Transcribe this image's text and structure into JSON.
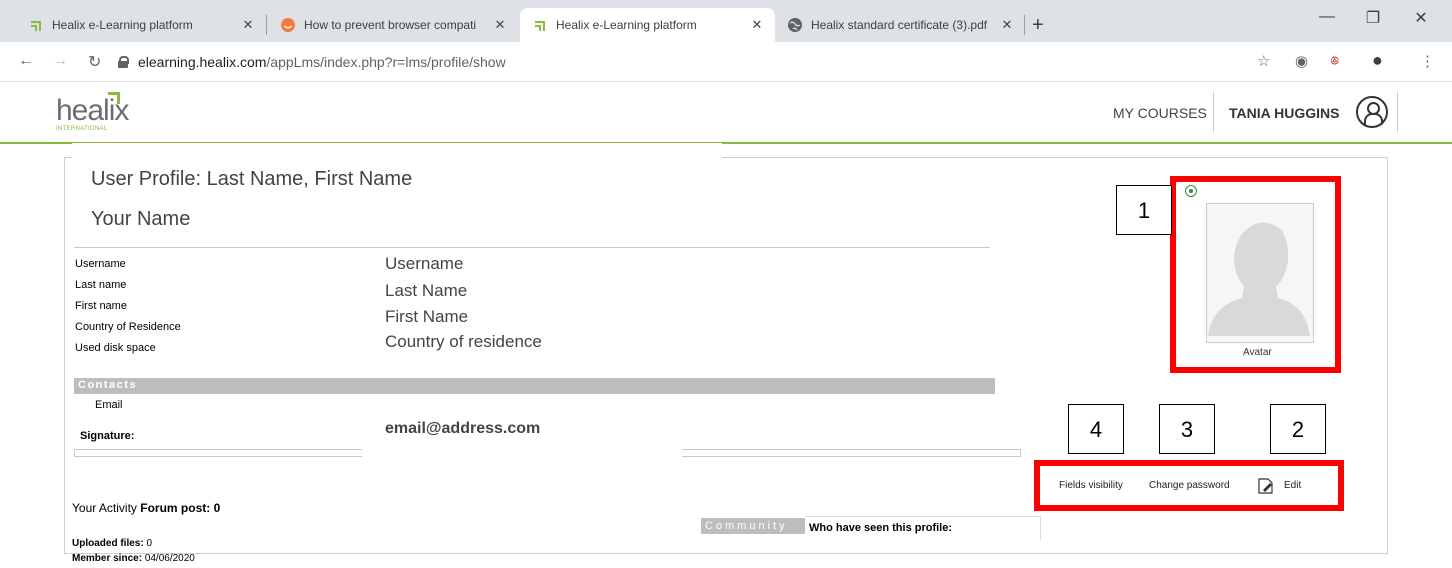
{
  "browser": {
    "tabs": [
      {
        "title": "Healix e-Learning platform",
        "favicon": "healix-icon",
        "active": false
      },
      {
        "title": "How to prevent browser compati",
        "favicon": "orange-smiley-icon",
        "active": false
      },
      {
        "title": "Healix e-Learning platform",
        "favicon": "healix-icon",
        "active": true
      },
      {
        "title": "Healix standard certificate (3).pdf",
        "favicon": "globe-icon",
        "active": false
      }
    ],
    "url_host": "elearning.healix.com",
    "url_path": "/appLms/index.php?r=lms/profile/show"
  },
  "site": {
    "logo_text": "healix",
    "logo_sub": "INTERNATIONAL",
    "nav_courses": "MY COURSES",
    "nav_user": "TANIA HUGGINS"
  },
  "profile": {
    "title": "User Profile: Last Name, First Name",
    "name": "Your Name",
    "fields": [
      {
        "label": "Username",
        "value": "Username"
      },
      {
        "label": "Last name",
        "value": "Last Name"
      },
      {
        "label": "First name",
        "value": "First Name"
      },
      {
        "label": "Country of Residence",
        "value": "Country of residence"
      },
      {
        "label": "Used disk space",
        "value": ""
      }
    ],
    "contacts_header": "Contacts",
    "email_label": "Email",
    "email_value": "email@address.com",
    "signature_label": "Signature:",
    "avatar_label": "Avatar",
    "actions": {
      "fields_visibility": "Fields visibility",
      "change_password": "Change password",
      "edit": "Edit"
    }
  },
  "activity": {
    "label": "Your Activity",
    "forum_post_label": "Forum post:",
    "forum_post_value": "0",
    "uploaded_files_label": "Uploaded files:",
    "uploaded_files_value": "0",
    "member_since_label": "Member since:",
    "member_since_value": "04/06/2020"
  },
  "community": {
    "header": "Community",
    "who_seen": "Who have seen this profile:"
  },
  "callouts": [
    "1",
    "2",
    "3",
    "4"
  ],
  "colors": {
    "accent_green": "#8bba3f",
    "highlight_red": "#ff0000"
  }
}
